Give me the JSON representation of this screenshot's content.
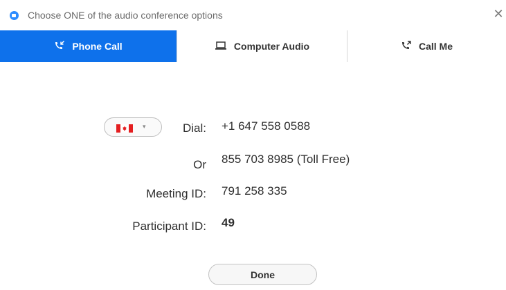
{
  "window": {
    "title": "Choose ONE of the audio conference options",
    "close_glyph": "✕"
  },
  "tabs": [
    {
      "label": "Phone Call",
      "icon": "phone-call-icon",
      "active": true
    },
    {
      "label": "Computer Audio",
      "icon": "laptop-icon",
      "active": false
    },
    {
      "label": "Call Me",
      "icon": "phone-call-icon",
      "active": false
    }
  ],
  "colors": {
    "accent": "#0e71eb",
    "zoom_blue": "#2D8CFF",
    "flag_red": "#e41e20"
  },
  "country_selector": {
    "flag": "canada-flag-icon",
    "caret": "▾"
  },
  "details": {
    "dial_label": "Dial:",
    "dial_number": "+1 647 558 0588",
    "or_label": "Or",
    "toll_free_number": "855 703 8985 (Toll Free)",
    "meeting_id_label": "Meeting ID:",
    "meeting_id": "791 258 335",
    "participant_id_label": "Participant ID:",
    "participant_id": "49"
  },
  "done_label": "Done"
}
